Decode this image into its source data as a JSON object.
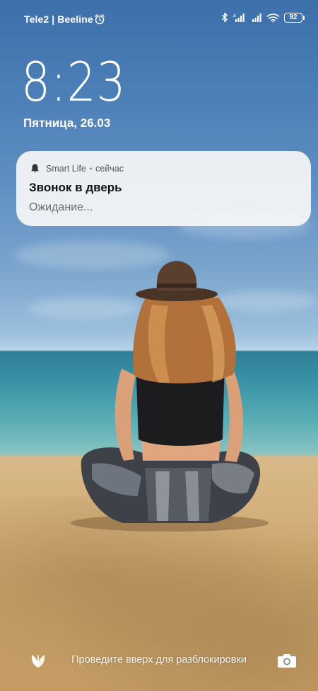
{
  "status_bar": {
    "carrier": "Tele2 | Beeline",
    "battery_level": "92",
    "icons": [
      "alarm-icon",
      "bluetooth-icon",
      "signal-icon",
      "signal-icon",
      "wifi-icon",
      "battery-icon"
    ]
  },
  "lockscreen": {
    "time": "8:23",
    "date": "Пятница, 26.03"
  },
  "notification": {
    "app_name": "Smart Life",
    "separator": "•",
    "time": "сейчас",
    "title": "Звонок в дверь",
    "body": "Ожидание...",
    "icon": "bell-icon"
  },
  "bottom_bar": {
    "unlock_hint": "Проведите вверх для разблокировки",
    "left_shortcut_icon": "plant-icon",
    "right_shortcut_icon": "camera-icon"
  },
  "colors": {
    "notification_bg": "#f6f6f8",
    "text_primary": "#ffffff"
  }
}
